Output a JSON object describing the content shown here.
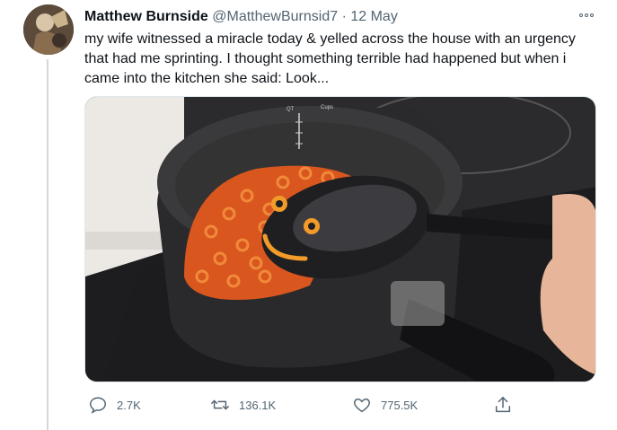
{
  "tweet": {
    "display_name": "Matthew Burnside",
    "handle": "@MatthewBurnsid7",
    "separator": "·",
    "date": "12 May",
    "text": "my wife witnessed a miracle today & yelled across the house with an urgency that had me sprinting. I thought something terrible had happened but when i came into the kitchen she said: Look...",
    "media": {
      "pot_label_qt": "QT",
      "pot_label_cups": "Cups",
      "pot_marks": [
        "2.5",
        "2",
        "1.5",
        "10",
        "8",
        "6"
      ]
    }
  },
  "actions": {
    "reply_count": "2.7K",
    "retweet_count": "136.1K",
    "like_count": "775.5K"
  },
  "icons": {
    "reply": "reply-icon",
    "retweet": "retweet-icon",
    "like": "heart-icon",
    "share": "share-icon",
    "more": "more-options-icon"
  }
}
